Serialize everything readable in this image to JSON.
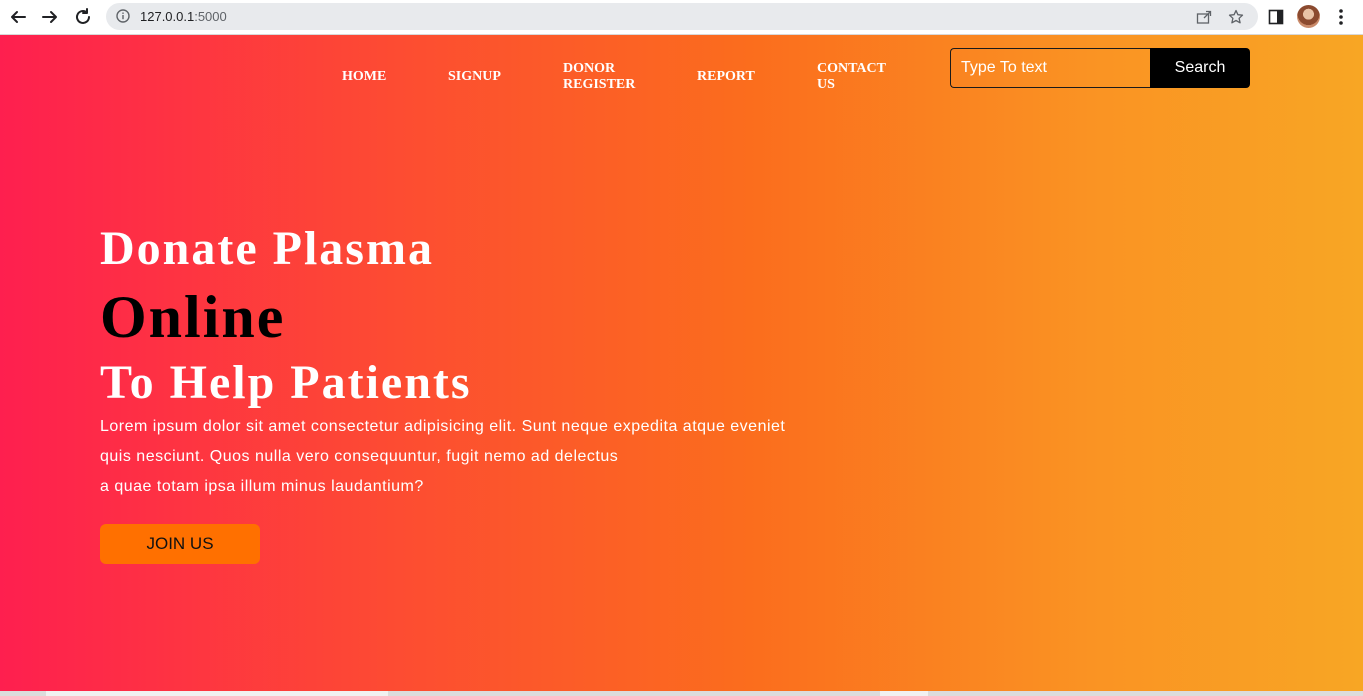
{
  "browser": {
    "url_host": "127.0.0.1",
    "url_port": ":5000",
    "icons": [
      "back-arrow-icon",
      "forward-arrow-icon",
      "reload-icon",
      "info-icon",
      "share-icon",
      "star-icon",
      "side-panel-icon",
      "profile-avatar",
      "kebab-menu-icon"
    ]
  },
  "nav": {
    "home": "HOME",
    "signup": "SIGNUP",
    "donor_register_1": "DONOR",
    "donor_register_2": "REGISTER",
    "report": "REPORT",
    "contact_1": "CONTACT",
    "contact_2": "US"
  },
  "search": {
    "placeholder": "Type To text",
    "button_label": "Search"
  },
  "hero": {
    "line1": "Donate Plasma",
    "line2": "Online",
    "line3": "To Help Patients",
    "paragraph": [
      "Lorem ipsum dolor sit amet consectetur adipisicing elit. Sunt neque expedita atque eveniet",
      "quis nesciunt. Quos nulla vero consequuntur, fugit nemo ad delectus",
      "a quae totam ipsa illum minus laudantium?"
    ],
    "cta_label": "JOIN US"
  },
  "colors": {
    "gradient_start": "#fe1f4f",
    "gradient_end": "#f8a624",
    "cta": "#ff7000",
    "search_button": "#000000"
  }
}
